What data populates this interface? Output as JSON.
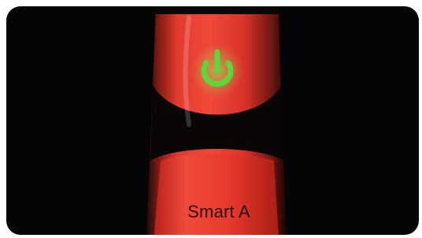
{
  "device": {
    "model_label": "Smart A",
    "power_icon": "power-icon",
    "power_icon_color": "#5fd63a",
    "body_color": "#e8352a",
    "accent_color": "#0a0606",
    "background_color": "#050407"
  }
}
